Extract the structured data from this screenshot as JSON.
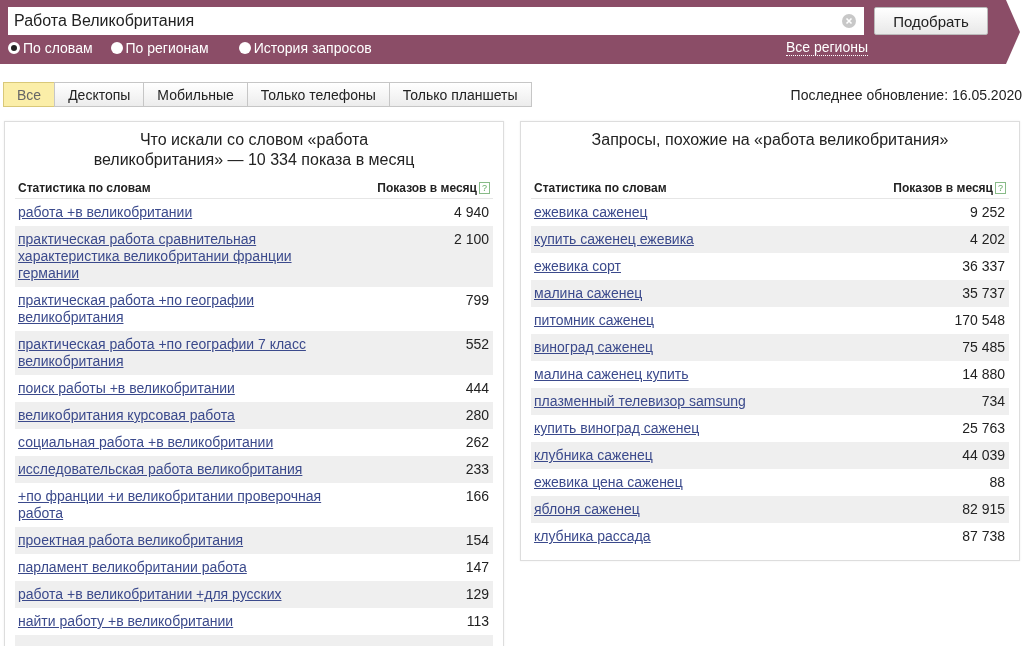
{
  "search": {
    "value": "Работа Великобритания",
    "button": "Подобрать"
  },
  "modes": [
    {
      "label": "По словам",
      "selected": true
    },
    {
      "label": "По регионам",
      "selected": false
    },
    {
      "label": "История запросов",
      "selected": false
    }
  ],
  "region_link": "Все регионы",
  "device_tabs": [
    {
      "label": "Все",
      "selected": true
    },
    {
      "label": "Десктопы",
      "selected": false
    },
    {
      "label": "Мобильные",
      "selected": false
    },
    {
      "label": "Только телефоны",
      "selected": false
    },
    {
      "label": "Только планшеты",
      "selected": false
    }
  ],
  "last_update": "Последнее обновление: 16.05.2020",
  "panels": [
    {
      "title": "Что искали со словом «работа великобритания» — 10 334 показа в месяц",
      "columns": [
        "Статистика по словам",
        "Показов в месяц"
      ],
      "help": "?",
      "rows": [
        {
          "phrase": "работа +в великобритании",
          "count": "4 940"
        },
        {
          "phrase": "практическая работа сравнительная характеристика великобритании франции германии",
          "count": "2 100"
        },
        {
          "phrase": "практическая работа +по географии великобритания",
          "count": "799"
        },
        {
          "phrase": "практическая работа +по географии 7 класс великобритания",
          "count": "552"
        },
        {
          "phrase": "поиск работы +в великобритании",
          "count": "444"
        },
        {
          "phrase": "великобритания курсовая работа",
          "count": "280"
        },
        {
          "phrase": "социальная работа +в великобритании",
          "count": "262"
        },
        {
          "phrase": "исследовательская работа великобритания",
          "count": "233"
        },
        {
          "phrase": "+по франции +и великобритании проверочная работа",
          "count": "166"
        },
        {
          "phrase": "проектная работа великобритания",
          "count": "154"
        },
        {
          "phrase": "парламент великобритании работа",
          "count": "147"
        },
        {
          "phrase": "работа +в великобритании +для русских",
          "count": "129"
        },
        {
          "phrase": "найти работу +в великобритании",
          "count": "113"
        }
      ]
    },
    {
      "title": "Запросы, похожие на «работа великобритания»",
      "columns": [
        "Статистика по словам",
        "Показов в месяц"
      ],
      "help": "?",
      "rows": [
        {
          "phrase": "ежевика саженец",
          "count": "9 252"
        },
        {
          "phrase": "купить саженец ежевика",
          "count": "4 202"
        },
        {
          "phrase": "ежевика сорт",
          "count": "36 337"
        },
        {
          "phrase": "малина саженец",
          "count": "35 737"
        },
        {
          "phrase": "питомник саженец",
          "count": "170 548"
        },
        {
          "phrase": "виноград саженец",
          "count": "75 485"
        },
        {
          "phrase": "малина саженец купить",
          "count": "14 880"
        },
        {
          "phrase": "плазменный телевизор samsung",
          "count": "734"
        },
        {
          "phrase": "купить виноград саженец",
          "count": "25 763"
        },
        {
          "phrase": "клубника саженец",
          "count": "44 039"
        },
        {
          "phrase": "ежевика цена саженец",
          "count": "88"
        },
        {
          "phrase": "яблоня саженец",
          "count": "82 915"
        },
        {
          "phrase": "клубника рассада",
          "count": "87 738"
        }
      ]
    }
  ]
}
